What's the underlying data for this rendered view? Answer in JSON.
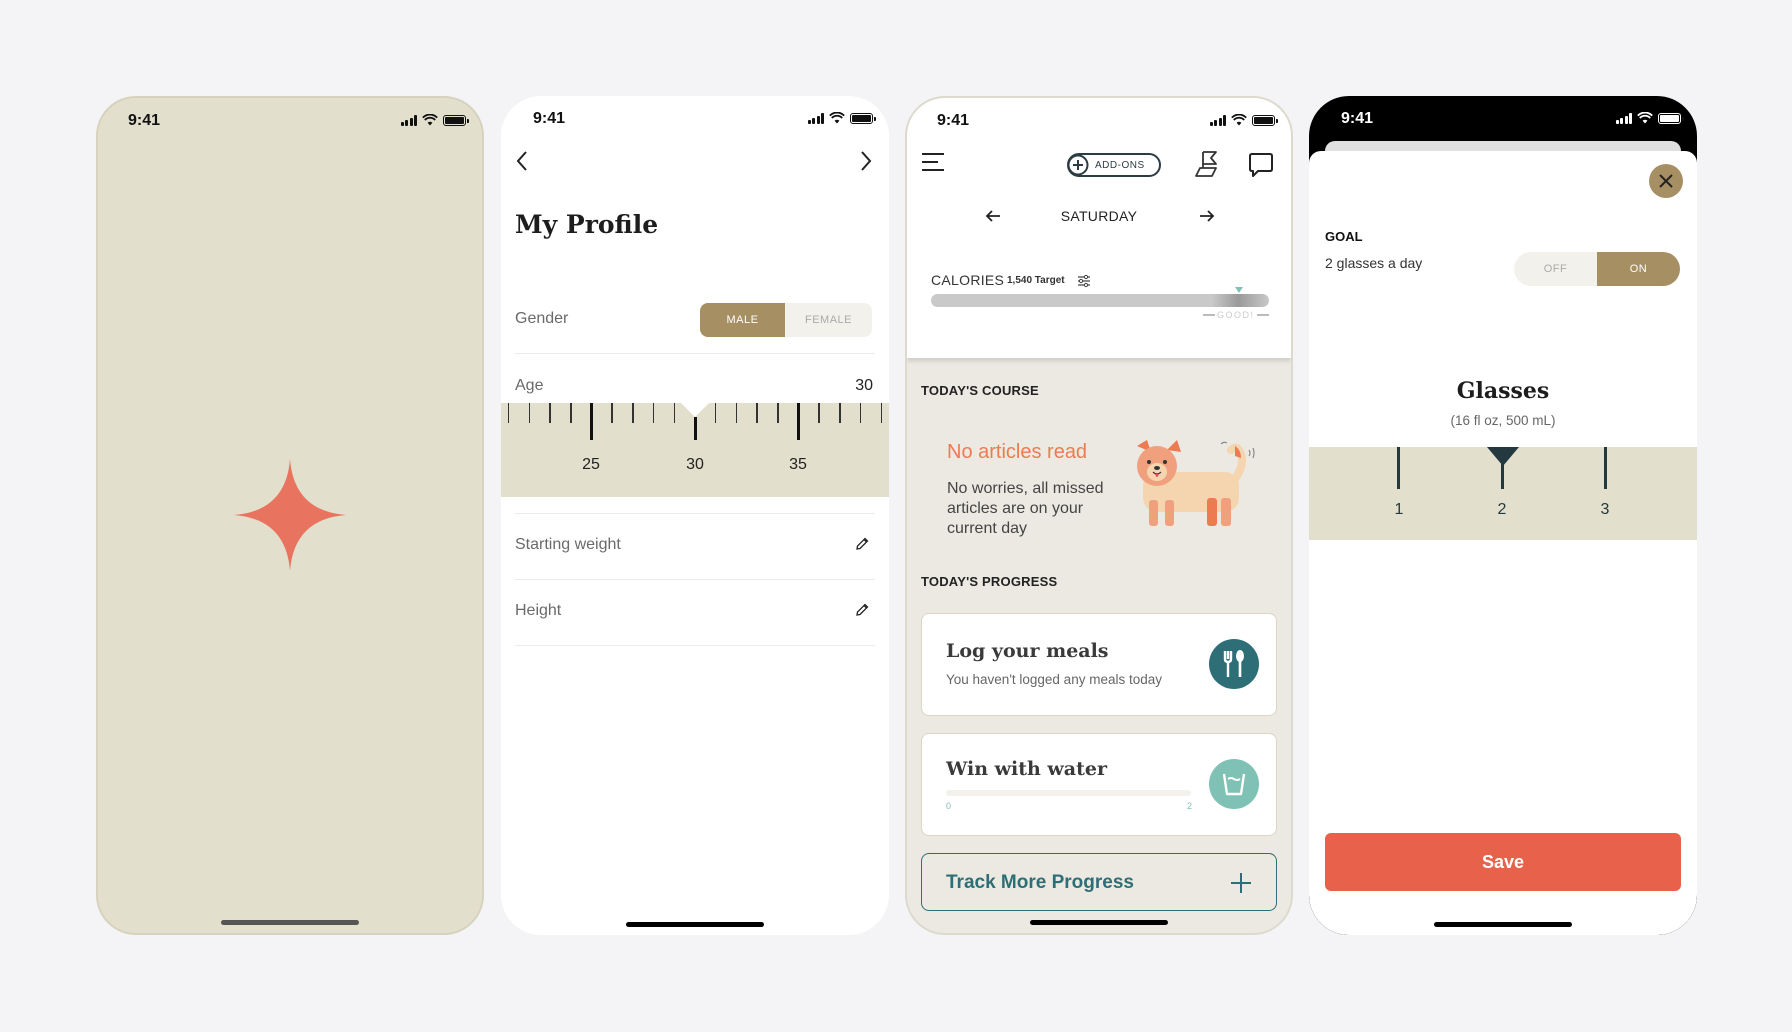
{
  "status_bar": {
    "time": "9:41"
  },
  "splash": {
    "logo": "sparkle-star-icon",
    "accent": "#e8735e"
  },
  "profile": {
    "back_icon": "chevron-left-icon",
    "forward_icon": "chevron-right-icon",
    "title": "My Profile",
    "gender": {
      "label": "Gender",
      "options": [
        "MALE",
        "FEMALE"
      ],
      "selected": "MALE"
    },
    "age": {
      "label": "Age",
      "value": "30",
      "ruler_labels": [
        "25",
        "30",
        "35"
      ]
    },
    "rows": [
      {
        "label": "Starting weight",
        "icon": "pencil-icon"
      },
      {
        "label": "Height",
        "icon": "pencil-icon"
      }
    ],
    "accent": "#a78f64"
  },
  "dashboard": {
    "menu_icon": "hamburger-menu-icon",
    "addons_label": "ADD-ONS",
    "flag_icon": "flag-icon",
    "chat_icon": "chat-bubble-icon",
    "day": "SATURDAY",
    "calories": {
      "label": "CALORIES",
      "target": "1,540 Target",
      "status": "GOOD!"
    },
    "course": {
      "heading": "TODAY'S COURSE",
      "title": "No articles read",
      "body": "No worries, all missed articles are on your current day"
    },
    "progress": {
      "heading": "TODAY'S PROGRESS",
      "meals": {
        "title": "Log your meals",
        "subtitle": "You haven't logged any meals today",
        "icon": "fork-spoon-icon"
      },
      "water": {
        "title": "Win with water",
        "min": "0",
        "max": "2",
        "value": 0,
        "icon": "water-glass-icon"
      },
      "track_more": "Track More Progress"
    },
    "colors": {
      "teal": "#2e6e77",
      "mint": "#7fc1b5",
      "orange": "#ee7a52"
    }
  },
  "water_goal": {
    "goal_heading": "GOAL",
    "goal_value": "2 glasses a day",
    "toggle": {
      "options": [
        "OFF",
        "ON"
      ],
      "selected": "ON"
    },
    "unit_title": "Glasses",
    "unit_subtitle": "(16 fl oz, 500 mL)",
    "ruler_labels": [
      "1",
      "2",
      "3"
    ],
    "selected": "2",
    "save_label": "Save",
    "save_color": "#e8614a"
  }
}
